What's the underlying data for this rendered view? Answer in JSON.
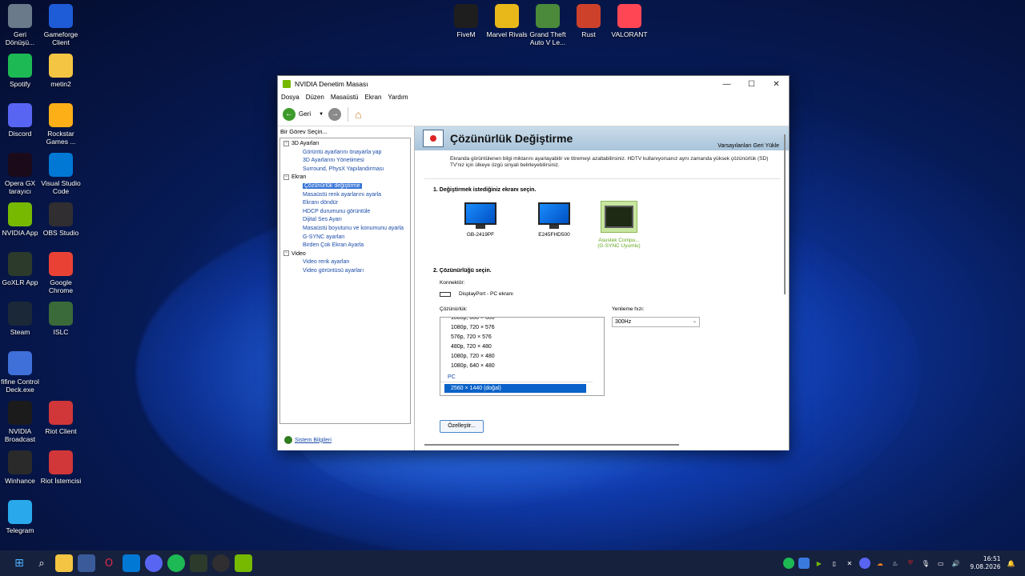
{
  "desktop": {
    "left_icons": [
      {
        "label": "Geri\nDönüşü...",
        "icon": "recycle-bin-icon",
        "color": "#6a7a8a"
      },
      {
        "label": "Gameforge\nClient",
        "icon": "gameforge-icon",
        "color": "#1e5bd7"
      },
      {
        "label": "Spotify",
        "icon": "spotify-icon",
        "color": "#1db954"
      },
      {
        "label": "metin2",
        "icon": "folder-icon",
        "color": "#f4c542"
      },
      {
        "label": "Discord",
        "icon": "discord-icon",
        "color": "#5865f2"
      },
      {
        "label": "Rockstar\nGames ...",
        "icon": "rockstar-icon",
        "color": "#fcaf17"
      },
      {
        "label": "Opera GX\ntarayıcı",
        "icon": "opera-gx-icon",
        "color": "#1a0a1a"
      },
      {
        "label": "Visual Studio\nCode",
        "icon": "vscode-icon",
        "color": "#0078d4"
      },
      {
        "label": "NVIDIA App",
        "icon": "nvidia-icon",
        "color": "#76b900"
      },
      {
        "label": "OBS Studio",
        "icon": "obs-icon",
        "color": "#302e31"
      },
      {
        "label": "GoXLR App",
        "icon": "goxlr-icon",
        "color": "#2b3a2b"
      },
      {
        "label": "Google\nChrome",
        "icon": "chrome-icon",
        "color": "#e94235"
      },
      {
        "label": "Steam",
        "icon": "steam-icon",
        "color": "#1b2838"
      },
      {
        "label": "ISLC",
        "icon": "islc-icon",
        "color": "#3a6a3a"
      },
      {
        "label": "fifine Control\nDeck.exe",
        "icon": "fifine-icon",
        "color": "#3f6fd8"
      },
      {
        "label": "NVIDIA\nBroadcast",
        "icon": "nvidia-broadcast-icon",
        "color": "#1b1b1b"
      },
      {
        "label": "Riot Client",
        "icon": "riot-icon",
        "color": "#d13639"
      },
      {
        "label": "Winhance",
        "icon": "winhance-icon",
        "color": "#2a2a2a"
      },
      {
        "label": "Riot İstemcisi",
        "icon": "riot-client-icon",
        "color": "#d13639"
      },
      {
        "label": "Telegram",
        "icon": "telegram-icon",
        "color": "#29a9eb"
      }
    ],
    "top_icons": [
      {
        "label": "FiveM",
        "icon": "fivem-icon",
        "color": "#1e1e1e"
      },
      {
        "label": "Marvel Rivals",
        "icon": "marvel-rivals-icon",
        "color": "#e8b81a"
      },
      {
        "label": "Grand Theft\nAuto V Le...",
        "icon": "gta-icon",
        "color": "#4a8a3a"
      },
      {
        "label": "Rust",
        "icon": "rust-icon",
        "color": "#cd412b"
      },
      {
        "label": "VALORANT",
        "icon": "valorant-icon",
        "color": "#ff4655"
      }
    ]
  },
  "window": {
    "title": "NVIDIA Denetim Masası",
    "menu": [
      "Dosya",
      "Düzen",
      "Masaüstü",
      "Ekran",
      "Yardım"
    ],
    "back_label": "Geri",
    "task_header": "Bir Görev Seçin...",
    "tree": [
      {
        "label": "3D Ayarları",
        "items": [
          "Görüntü ayarlarını önayarla yap",
          "3D Ayarlarını Yönetimesi",
          "Surround, PhysX Yapılandırması"
        ]
      },
      {
        "label": "Ekran",
        "items": [
          "Çözünürlük değiştirme",
          "Masaüstü renk ayarlarını ayarla",
          "Ekranı döndür",
          "HDCP durumunu görüntüle",
          "Dijital Ses Ayarı",
          "Masaüstü boyutunu ve konumunu ayarla",
          "G-SYNC ayarları",
          "Birden Çok Ekran Ayarla"
        ]
      },
      {
        "label": "Video",
        "items": [
          "Video renk ayarları",
          "Video görüntüsü ayarları"
        ]
      }
    ],
    "selected_item": "Çözünürlük değiştirme",
    "system_info": "Sistem Bilgileri",
    "page_title": "Çözünürlük Değiştirme",
    "restore_defaults": "Varsayılanları Geri Yükle",
    "description": "Ekranda görüntülenen bilgi miktarını ayarlayabilir ve titremeyi azaltabilirsiniz. HDTV kullanıyorsanız aynı zamanda yüksek çözünürlük (SD) TV'niz için ülkeye özgü sinyali belirleyebilirsiniz.",
    "step1": "1. Değiştirmek istediğiniz ekranı seçin.",
    "monitors": [
      {
        "name": "GB-2419PF",
        "sub": "",
        "active": false
      },
      {
        "name": "E245FHD500",
        "sub": "",
        "active": false
      },
      {
        "name": "Asustek Compu...",
        "sub": "(G-SYNC Uyumlu)",
        "active": true
      }
    ],
    "step2": "2. Çözünürlüğü seçin.",
    "connector_label": "Konnektör:",
    "connector_value": "DisplayPort - PC ekranı",
    "resolution_label": "Çözünürlük:",
    "resolutions": [
      "1080p, 800 × 600",
      "1080p, 720 × 576",
      "576p, 720 × 576",
      "480p, 720 × 480",
      "1080p, 720 × 480",
      "1080p, 640 × 480"
    ],
    "pc_group": "PC",
    "selected_resolution": "2560 × 1440 (doğal)",
    "refresh_label": "Yenileme hızı:",
    "refresh_value": "300Hz",
    "customize_button": "Özelleştir..."
  },
  "taskbar": {
    "time": "16:51",
    "date": "9.08.2026"
  }
}
